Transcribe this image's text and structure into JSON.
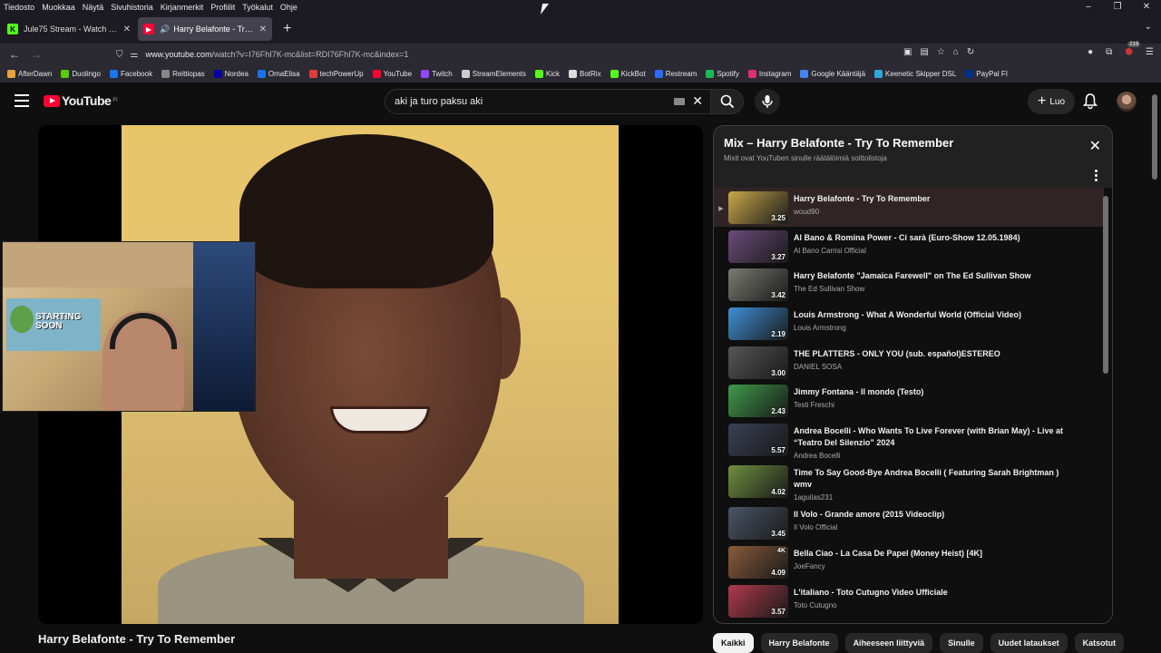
{
  "browser": {
    "menu": [
      "Tiedosto",
      "Muokkaa",
      "Näytä",
      "Sivuhistoria",
      "Kirjanmerkit",
      "Profiilit",
      "Työkalut",
      "Ohje"
    ],
    "tabs": [
      {
        "title": "Jule75 Stream - Watch Live on K",
        "favicon_color": "#53fc18",
        "favicon_glyph": "K"
      },
      {
        "title": "Harry Belafonte - Try To Rem",
        "favicon_color": "#ff0033",
        "favicon_glyph": "▶"
      }
    ],
    "url_host": "www.youtube.com",
    "url_path": "/watch?v=I76FhI7K-mc&list=RDI76FhI7K-mc&index=1",
    "ext_badge": "219",
    "bookmarks": [
      {
        "label": "AfterDawn",
        "color": "#e8a33c"
      },
      {
        "label": "Duolingo",
        "color": "#58cc02"
      },
      {
        "label": "Facebook",
        "color": "#1877f2"
      },
      {
        "label": "Reittiopas",
        "color": "#888888"
      },
      {
        "label": "Nordea",
        "color": "#0000a0"
      },
      {
        "label": "OmaElisa",
        "color": "#1a73e8"
      },
      {
        "label": "techPowerUp",
        "color": "#e03a3a"
      },
      {
        "label": "YouTube",
        "color": "#ff0033"
      },
      {
        "label": "Twitch",
        "color": "#9146ff"
      },
      {
        "label": "StreamElements",
        "color": "#cccccc"
      },
      {
        "label": "Kick",
        "color": "#53fc18"
      },
      {
        "label": "BotRix",
        "color": "#dddddd"
      },
      {
        "label": "KickBot",
        "color": "#53fc18"
      },
      {
        "label": "Restream",
        "color": "#2b6cff"
      },
      {
        "label": "Spotify",
        "color": "#1db954"
      },
      {
        "label": "Instagram",
        "color": "#e1306c"
      },
      {
        "label": "Google Kääntäjä",
        "color": "#4285f4"
      },
      {
        "label": "Keenetic Skipper DSL",
        "color": "#29a8e0"
      },
      {
        "label": "PayPal FI",
        "color": "#003087"
      }
    ]
  },
  "youtube": {
    "logo_text": "YouTube",
    "logo_region": "FI",
    "search_value": "aki ja turo paksu aki",
    "create_label": "Luo",
    "video_title": "Harry Belafonte - Try To Remember",
    "webcam_poster_text": "STARTING SOON"
  },
  "playlist": {
    "title": "Mix – Harry Belafonte - Try To Remember",
    "subtitle": "Mixit ovat YouTuben sinulle räätälöimiä soittolistoja",
    "items": [
      {
        "title": "Harry Belafonte - Try To Remember",
        "channel": "woud90",
        "duration": "3.25",
        "active": true,
        "thumb": "#c9a84a"
      },
      {
        "title": "Al Bano & Romina Power - Ci sarà (Euro-Show 12.05.1984)",
        "channel": "Al Bano Carrisi Official",
        "duration": "3.27",
        "thumb": "#6b4a7c"
      },
      {
        "title": "Harry Belafonte \"Jamaica Farewell\" on The Ed Sullivan Show",
        "channel": "The Ed Sullivan Show",
        "duration": "3.42",
        "thumb": "#7a7a72"
      },
      {
        "title": "Louis Armstrong - What A Wonderful World (Official Video)",
        "channel": "Louis Armstrong",
        "duration": "2.19",
        "thumb": "#3d8fd6"
      },
      {
        "title": "THE PLATTERS - ONLY YOU (sub. español)ESTEREO",
        "channel": "DANIEL SOSA",
        "duration": "3.00",
        "thumb": "#555555"
      },
      {
        "title": "Jimmy Fontana - Il mondo (Testo)",
        "channel": "Testi Freschi",
        "duration": "2.43",
        "thumb": "#3f9a4a"
      },
      {
        "title": "Andrea Bocelli - Who Wants To Live Forever (with Brian May) - Live at “Teatro Del Silenzio” 2024",
        "channel": "Andrea Bocelli",
        "duration": "5.57",
        "thumb": "#3a3f55",
        "tall": true
      },
      {
        "title": "Time To Say Good-Bye Andrea Bocelli ( Featuring Sarah Brightman ) wmv",
        "channel": "1aguilas231",
        "duration": "4.02",
        "thumb": "#6f8f3f",
        "tall": true
      },
      {
        "title": "Il Volo - Grande amore (2015 Videoclip)",
        "channel": "Il Volo Official",
        "duration": "3.45",
        "thumb": "#4a5566"
      },
      {
        "title": "Bella Ciao - La Casa De Papel (Money Heist) [4K]",
        "channel": "JoeFancy",
        "duration": "4.09",
        "thumb": "#8a5a3a",
        "badge": "4K"
      },
      {
        "title": "L'italiano - Toto Cutugno Video Ufficiale",
        "channel": "Toto Cutugno",
        "duration": "3.57",
        "thumb": "#b03a4a"
      }
    ]
  },
  "chips": [
    "Kaikki",
    "Harry Belafonte",
    "Aiheeseen liittyviä",
    "Sinulle",
    "Uudet lataukset",
    "Katsotut"
  ]
}
